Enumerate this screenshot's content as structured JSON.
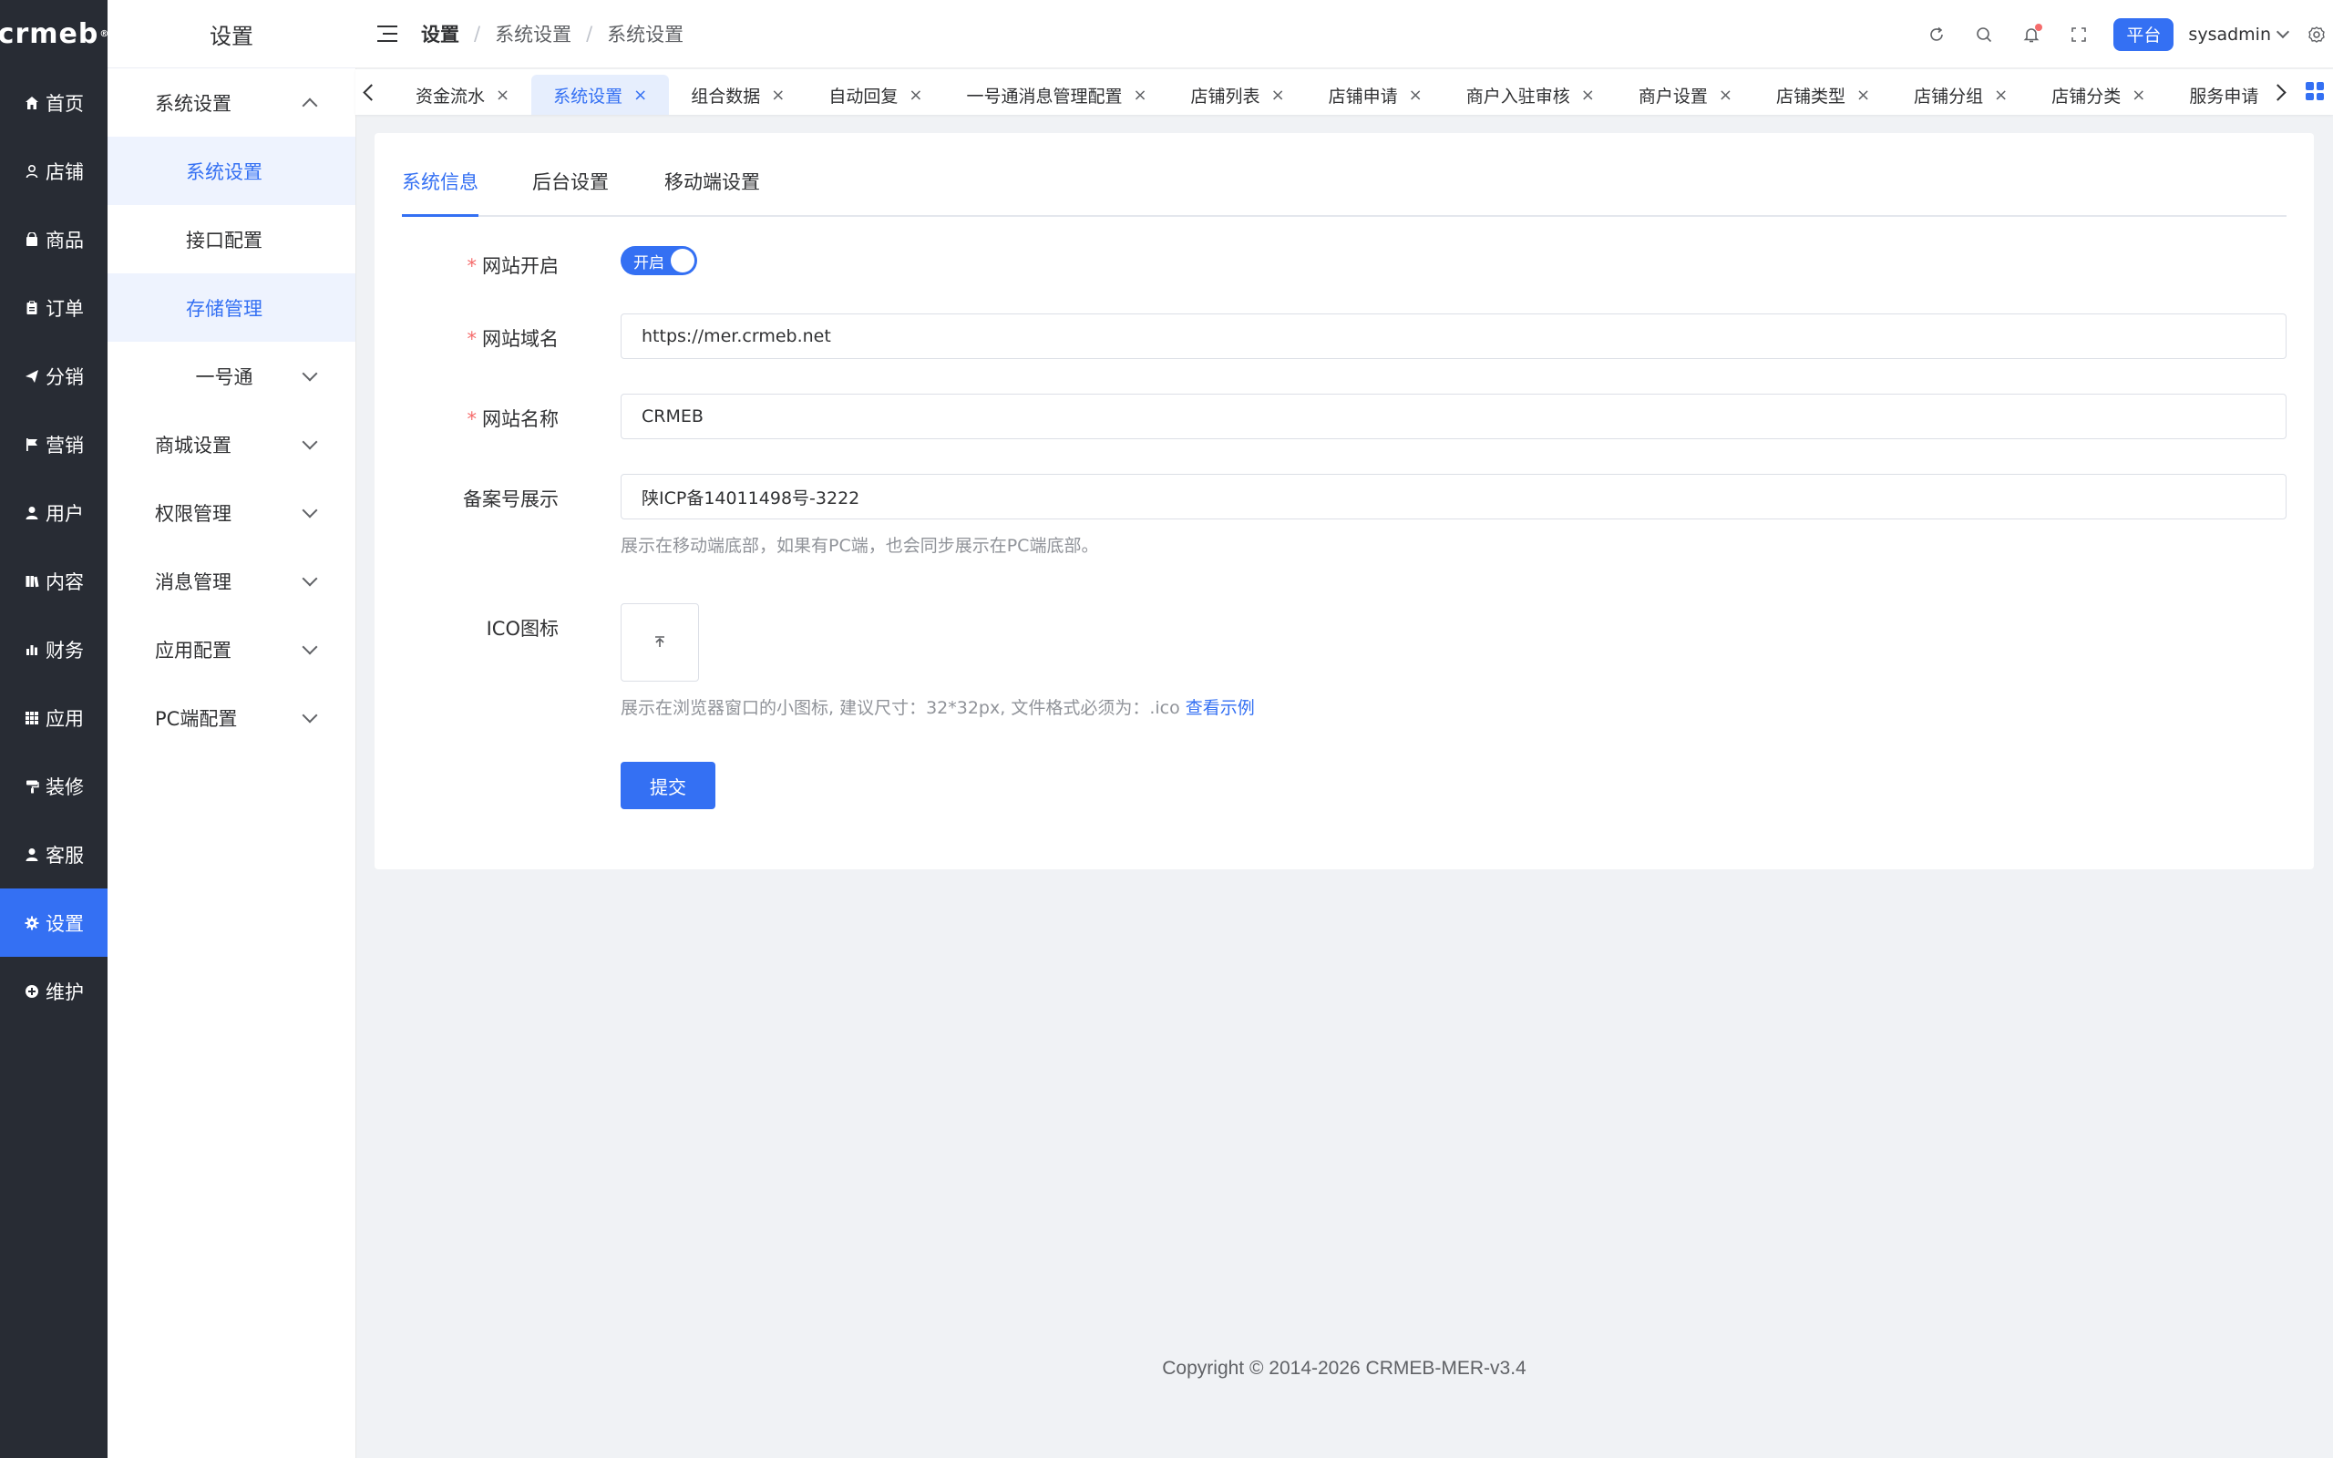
{
  "app": {
    "logo_text": "crmeb"
  },
  "nav1": {
    "items": [
      {
        "label": "首页",
        "icon": "home-icon"
      },
      {
        "label": "店铺",
        "icon": "shop-icon"
      },
      {
        "label": "商品",
        "icon": "goods-icon"
      },
      {
        "label": "订单",
        "icon": "order-icon"
      },
      {
        "label": "分销",
        "icon": "distribution-icon"
      },
      {
        "label": "营销",
        "icon": "flag-icon"
      },
      {
        "label": "用户",
        "icon": "user-icon"
      },
      {
        "label": "内容",
        "icon": "content-icon"
      },
      {
        "label": "财务",
        "icon": "finance-icon"
      },
      {
        "label": "应用",
        "icon": "apps-icon"
      },
      {
        "label": "装修",
        "icon": "decorate-icon"
      },
      {
        "label": "客服",
        "icon": "service-icon"
      },
      {
        "label": "设置",
        "icon": "gear-icon"
      },
      {
        "label": "维护",
        "icon": "maintain-icon"
      }
    ],
    "active": "设置"
  },
  "nav2": {
    "title": "设置",
    "items": [
      {
        "label": "系统设置"
      },
      {
        "label": "系统设置"
      },
      {
        "label": "接口配置"
      },
      {
        "label": "存储管理"
      },
      {
        "label": "一号通"
      },
      {
        "label": "商城设置"
      },
      {
        "label": "权限管理"
      },
      {
        "label": "消息管理"
      },
      {
        "label": "应用配置"
      },
      {
        "label": "PC端配置"
      }
    ]
  },
  "header": {
    "breadcrumb": [
      "设置",
      "系统设置",
      "系统设置"
    ],
    "separator": "/",
    "platform_label": "平台",
    "username": "sysadmin"
  },
  "tags": {
    "items": [
      {
        "label": "资金流水"
      },
      {
        "label": "系统设置"
      },
      {
        "label": "组合数据"
      },
      {
        "label": "自动回复"
      },
      {
        "label": "一号通消息管理配置"
      },
      {
        "label": "店铺列表"
      },
      {
        "label": "店铺申请"
      },
      {
        "label": "商户入驻审核"
      },
      {
        "label": "商户设置"
      },
      {
        "label": "店铺类型"
      },
      {
        "label": "店铺分组"
      },
      {
        "label": "店铺分类"
      },
      {
        "label": "服务申请"
      }
    ],
    "active": "系统设置",
    "close_glyph": "×"
  },
  "subtabs": {
    "items": [
      {
        "label": "系统信息"
      },
      {
        "label": "后台设置"
      },
      {
        "label": "移动端设置"
      }
    ],
    "active": "系统信息"
  },
  "form": {
    "site_open": {
      "label": "网站开启",
      "required": true,
      "value": "开启",
      "on": true
    },
    "site_domain": {
      "label": "网站域名",
      "required": true,
      "value": "https://mer.crmeb.net"
    },
    "site_name": {
      "label": "网站名称",
      "required": true,
      "value": "CRMEB"
    },
    "icp": {
      "label": "备案号展示",
      "required": false,
      "value": "陕ICP备14011498号-3222",
      "hint": "展示在移动端底部，如果有PC端，也会同步展示在PC端底部。"
    },
    "ico": {
      "label": "ICO图标",
      "required": false,
      "hint": "展示在浏览器窗口的小图标, 建议尺寸：32*32px, 文件格式必须为：.ico",
      "hint_link": "查看示例"
    },
    "required_mark": "*",
    "submit_label": "提交"
  },
  "footer": {
    "copyright": "Copyright © 2014-2026 CRMEB-MER-v3.4"
  },
  "colors": {
    "primary": "#3470f3",
    "sidebar_bg": "#282c34",
    "page_bg": "#f0f2f5"
  }
}
